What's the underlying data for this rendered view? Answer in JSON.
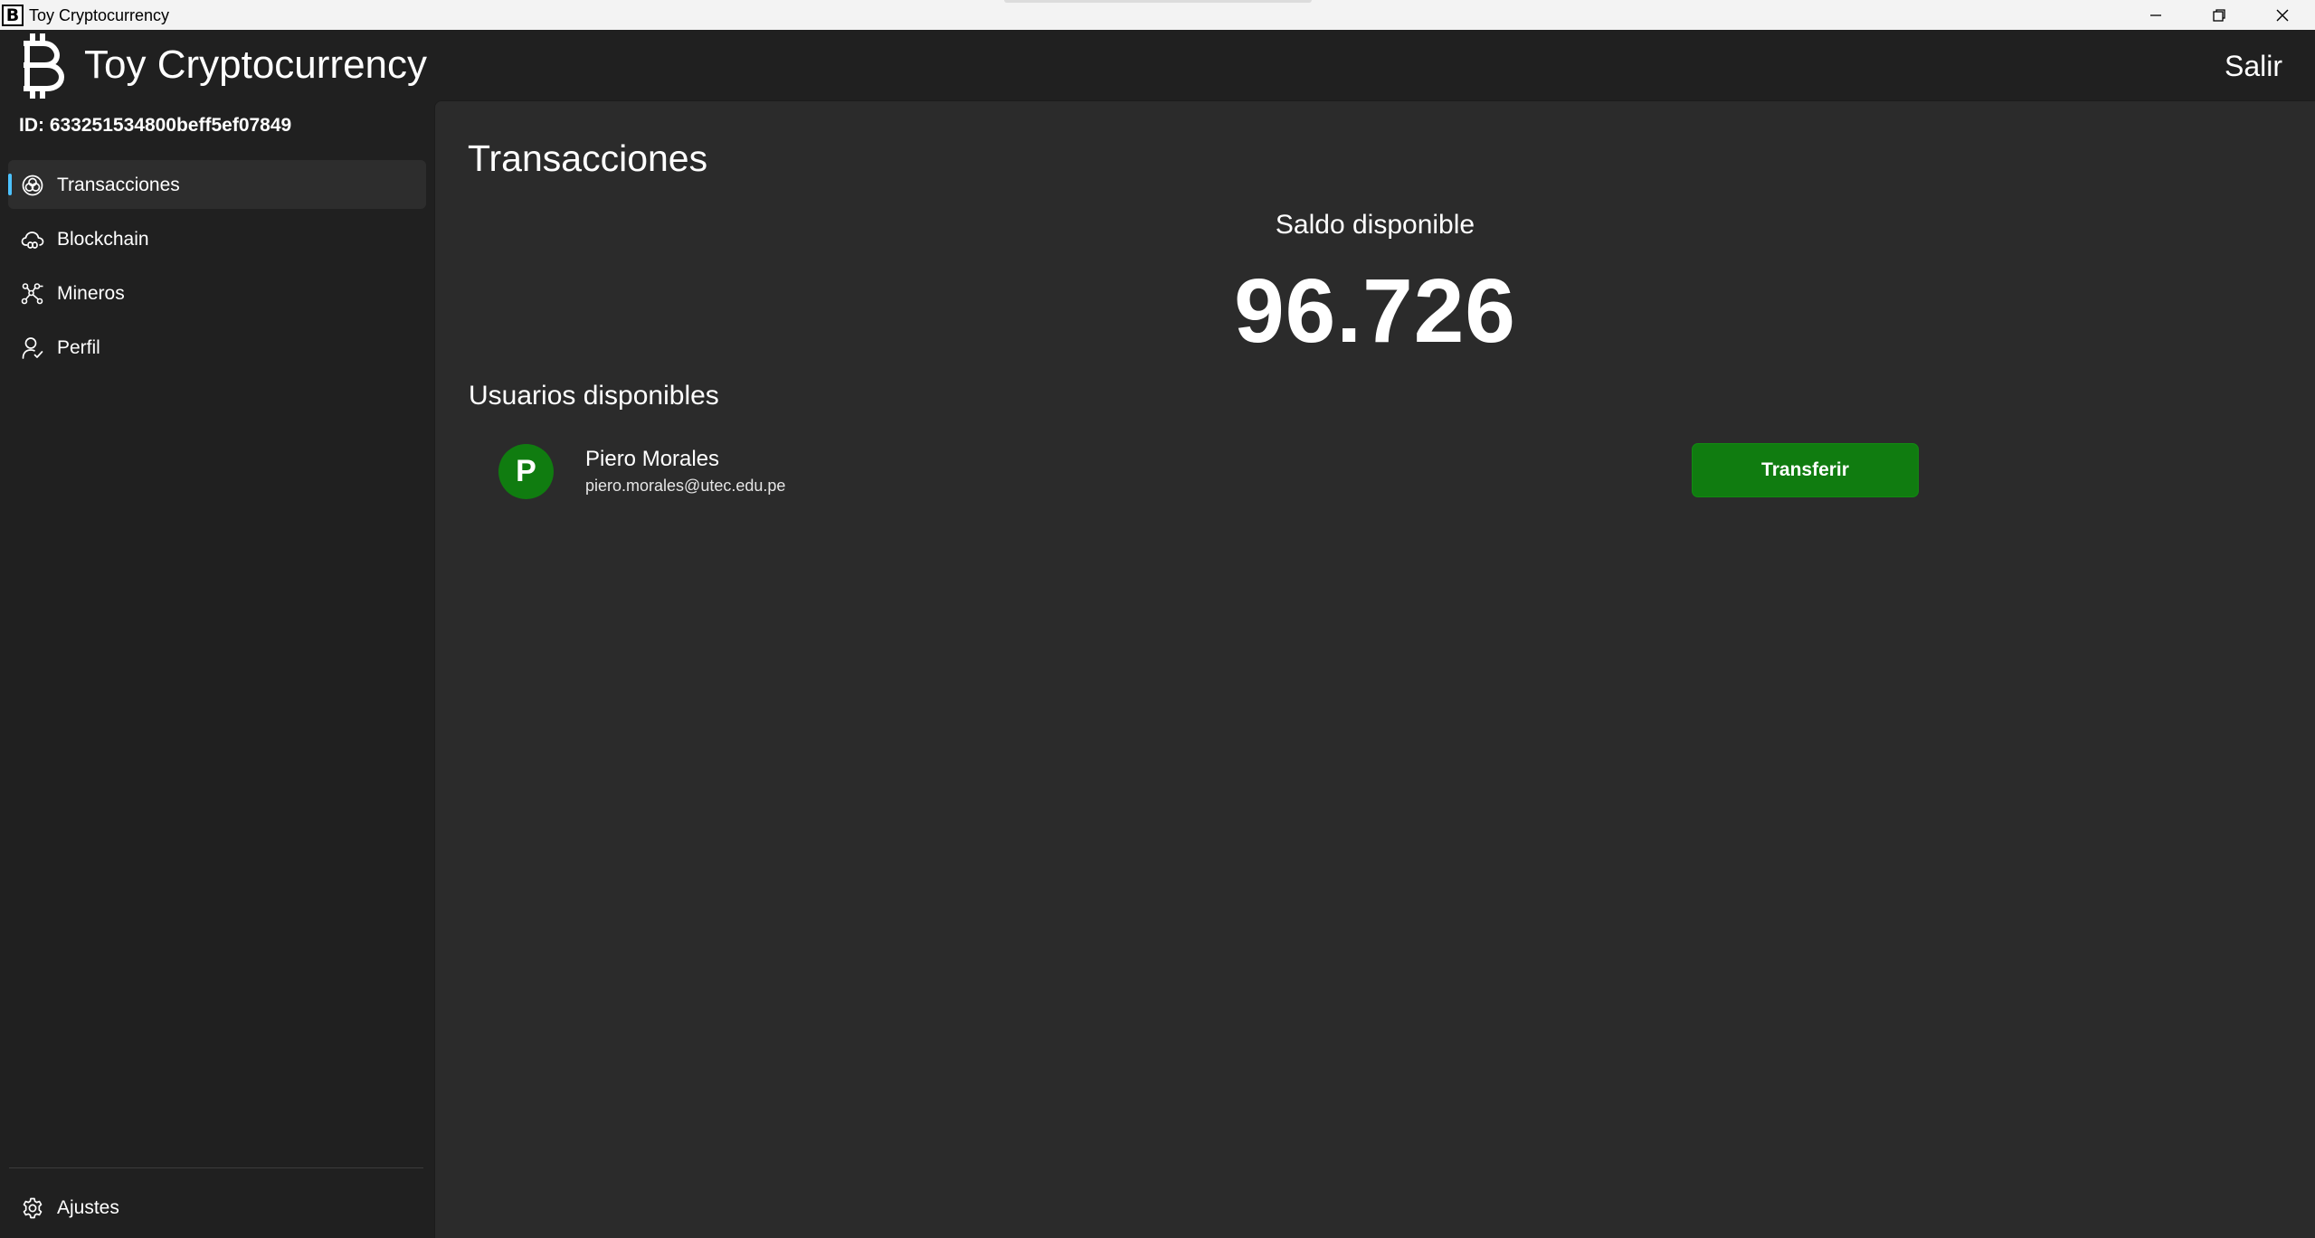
{
  "window": {
    "title": "Toy Cryptocurrency",
    "app_icon_glyph": "B",
    "controls": [
      "minimize-icon",
      "restore-icon",
      "close-icon"
    ]
  },
  "header": {
    "logo_icon": "bitcoin-icon",
    "brand": "Toy Cryptocurrency",
    "logout_label": "Salir"
  },
  "sidebar": {
    "user_id": "ID: 633251534800beff5ef07849",
    "items": [
      {
        "label": "Transacciones",
        "icon": "transactions-icon",
        "active": true
      },
      {
        "label": "Blockchain",
        "icon": "cloud-link-icon",
        "active": false
      },
      {
        "label": "Mineros",
        "icon": "network-icon",
        "active": false
      },
      {
        "label": "Perfil",
        "icon": "user-check-icon",
        "active": false
      }
    ],
    "footer": {
      "label": "Ajustes",
      "icon": "gear-icon"
    }
  },
  "main": {
    "title": "Transacciones",
    "balance_label": "Saldo disponible",
    "balance_value": "96.726",
    "users_heading": "Usuarios disponibles",
    "users": [
      {
        "initial": "P",
        "name": "Piero Morales",
        "email": "piero.morales@utec.edu.pe",
        "action_label": "Transferir"
      }
    ]
  },
  "colors": {
    "accent": "#4cc2ff",
    "success": "#107c10",
    "background": "#202020",
    "content": "#2b2b2b",
    "titlebar": "#f3f3f3"
  }
}
